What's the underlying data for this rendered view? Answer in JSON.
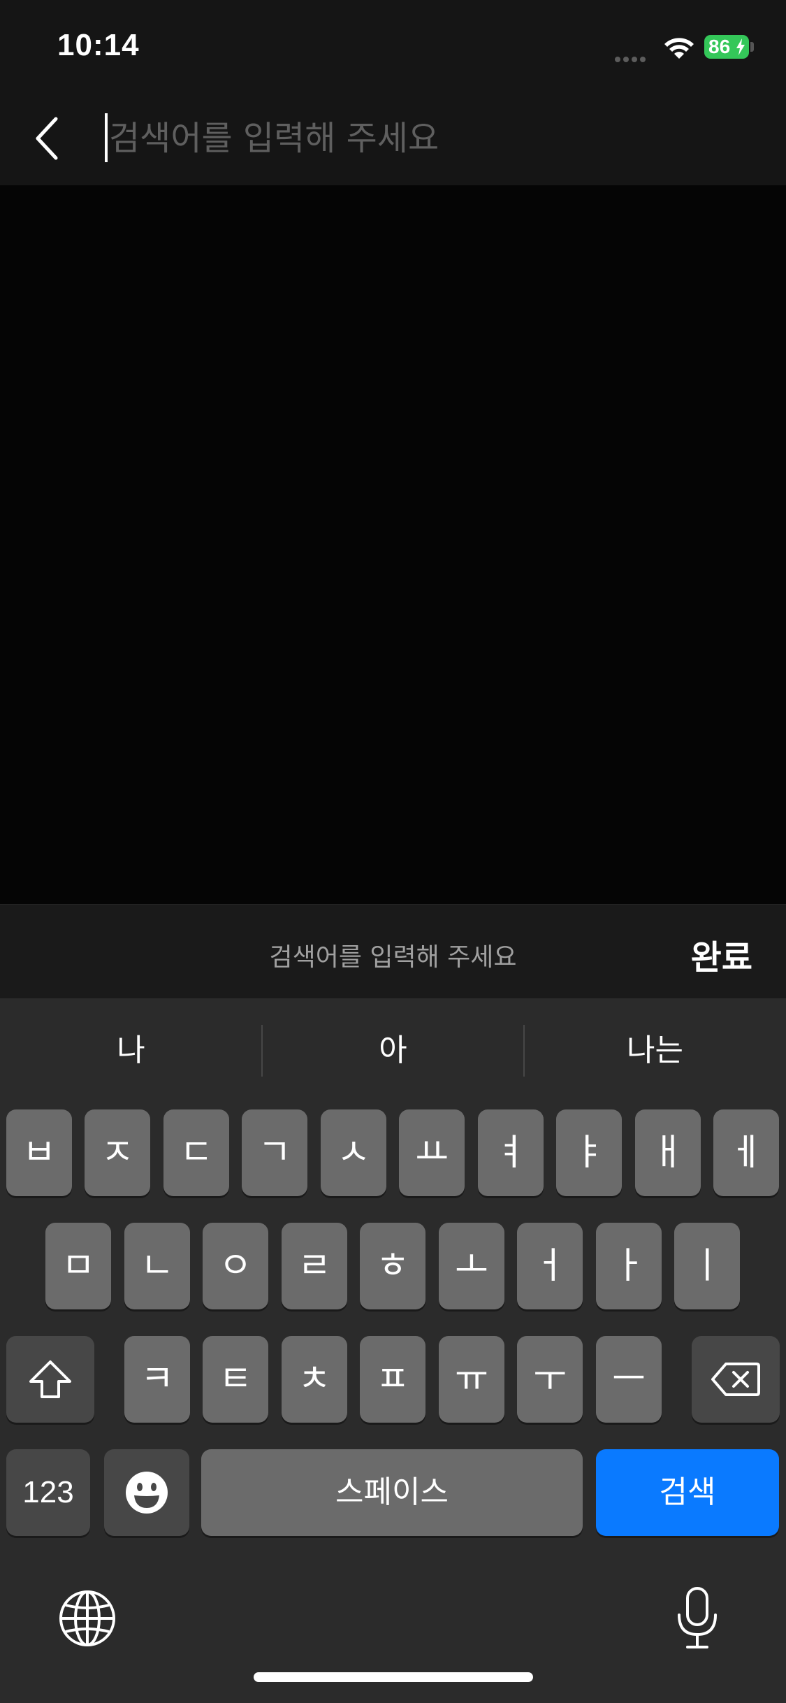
{
  "status_bar": {
    "time": "10:14",
    "battery_level": "86"
  },
  "search": {
    "placeholder": "검색어를 입력해 주세요"
  },
  "accessory": {
    "hint": "검색어를 입력해 주세요",
    "done_label": "완료"
  },
  "keyboard": {
    "suggestions": [
      "나",
      "아",
      "나는"
    ],
    "row1": [
      "ㅂ",
      "ㅈ",
      "ㄷ",
      "ㄱ",
      "ㅅ",
      "ㅛ",
      "ㅕ",
      "ㅑ",
      "ㅐ",
      "ㅔ"
    ],
    "row2": [
      "ㅁ",
      "ㄴ",
      "ㅇ",
      "ㄹ",
      "ㅎ",
      "ㅗ",
      "ㅓ",
      "ㅏ",
      "ㅣ"
    ],
    "row3": [
      "ㅋ",
      "ㅌ",
      "ㅊ",
      "ㅍ",
      "ㅠ",
      "ㅜ",
      "ㅡ"
    ],
    "numbers_label": "123",
    "space_label": "스페이스",
    "search_label": "검색",
    "icons": {
      "shift": "shift-icon",
      "delete": "delete-icon",
      "emoji": "emoji-icon",
      "globe": "globe-icon",
      "mic": "mic-icon"
    }
  },
  "colors": {
    "accent": "#0A7AFF",
    "battery": "#34C759"
  }
}
